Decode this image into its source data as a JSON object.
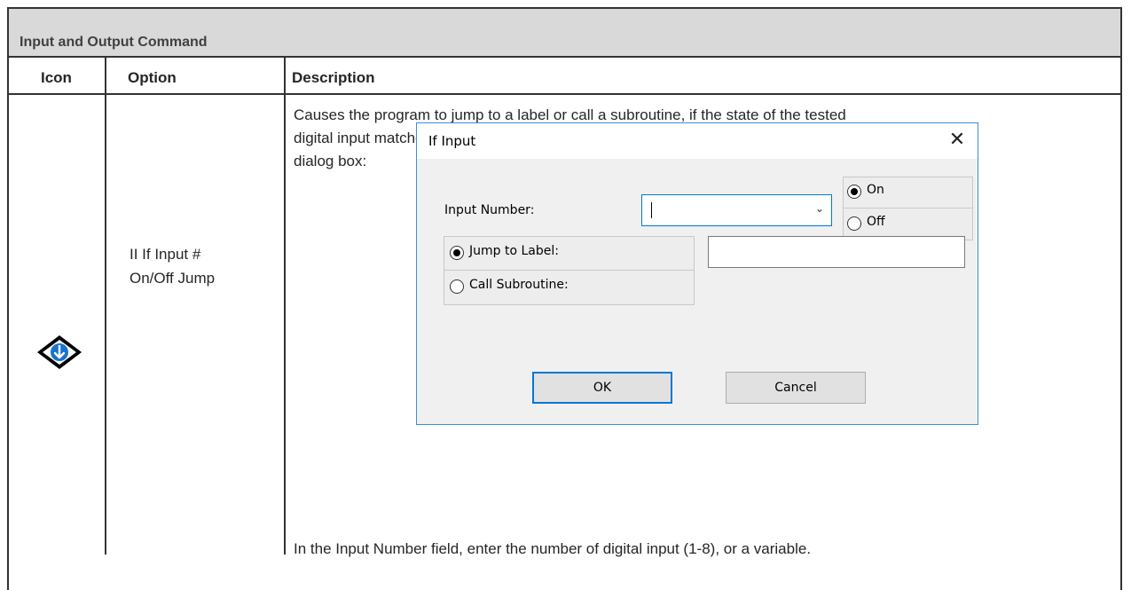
{
  "table": {
    "title": "Input and Output Command",
    "headers": {
      "icon": "Icon",
      "option": "Option",
      "description": "Description"
    },
    "row": {
      "icon": "if-input-jump-icon",
      "option_line1": "II If Input #",
      "option_line2": "On/Off Jump",
      "desc_line1": "Causes the program to jump to a label or call a subroutine, if the state of the tested",
      "desc_line2": "digital input matches the status specified (On or Off). The command opens this",
      "desc_line3": "dialog box:",
      "desc_after": "In the Input Number field, enter the number of digital input (1-8), or a variable."
    }
  },
  "dialog": {
    "title": "If Input",
    "close_glyph": "✕",
    "input_number_label": "Input Number:",
    "input_number_value": "",
    "state_on": "On",
    "state_off": "Off",
    "state_selected": "On",
    "jump_label": "Jump to Label:",
    "call_label": "Call Subroutine:",
    "target_selected": "Jump to Label",
    "target_value": "",
    "ok_label": "OK",
    "cancel_label": "Cancel"
  },
  "colors": {
    "accent": "#1a73c9",
    "title_bg": "#d9d9d9",
    "dialog_border": "#3b8fd8"
  }
}
